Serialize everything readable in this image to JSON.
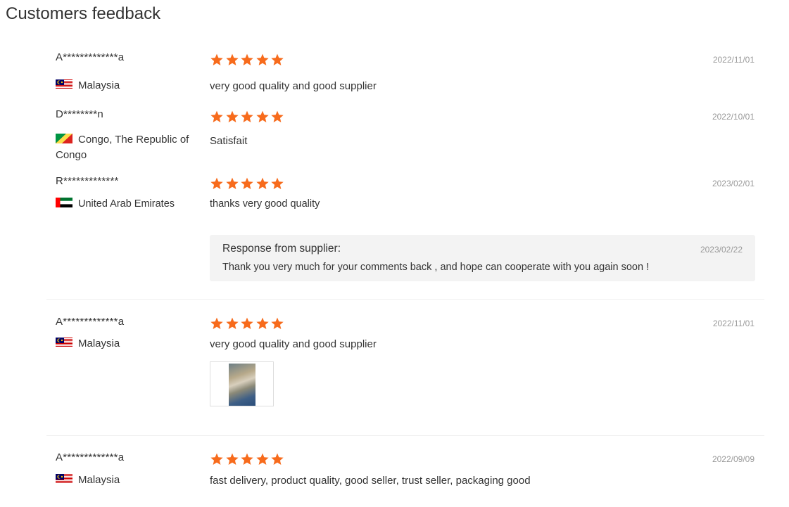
{
  "title": "Customers feedback",
  "colors": {
    "star": "#f76b1c",
    "date": "#999999",
    "response_bg": "#f3f3f3"
  },
  "reviews": [
    {
      "name": "A*************a",
      "country": "Malaysia",
      "flag": "malaysia-flag-icon",
      "rating": 5,
      "date": "2022/11/01",
      "comment": "very good quality and good supplier"
    },
    {
      "name": "D********n",
      "country": "Congo, The Republic of Congo",
      "flag": "congo-flag-icon",
      "rating": 5,
      "date": "2022/10/01",
      "comment": "Satisfait"
    },
    {
      "name": "R*************",
      "country": "United Arab Emirates",
      "flag": "uae-flag-icon",
      "rating": 5,
      "date": "2023/02/01",
      "comment": "thanks very good quality",
      "response": {
        "title": "Response from supplier:",
        "date": "2023/02/22",
        "text": "Thank you very much for your comments back , and hope can cooperate with you again soon !"
      }
    },
    {
      "name": "A*************a",
      "country": "Malaysia",
      "flag": "malaysia-flag-icon",
      "rating": 5,
      "date": "2022/11/01",
      "comment": "very good quality and good supplier",
      "has_photo": true
    },
    {
      "name": "A*************a",
      "country": "Malaysia",
      "flag": "malaysia-flag-icon",
      "rating": 5,
      "date": "2022/09/09",
      "comment": "fast delivery, product quality, good seller, trust seller, packaging good"
    }
  ]
}
